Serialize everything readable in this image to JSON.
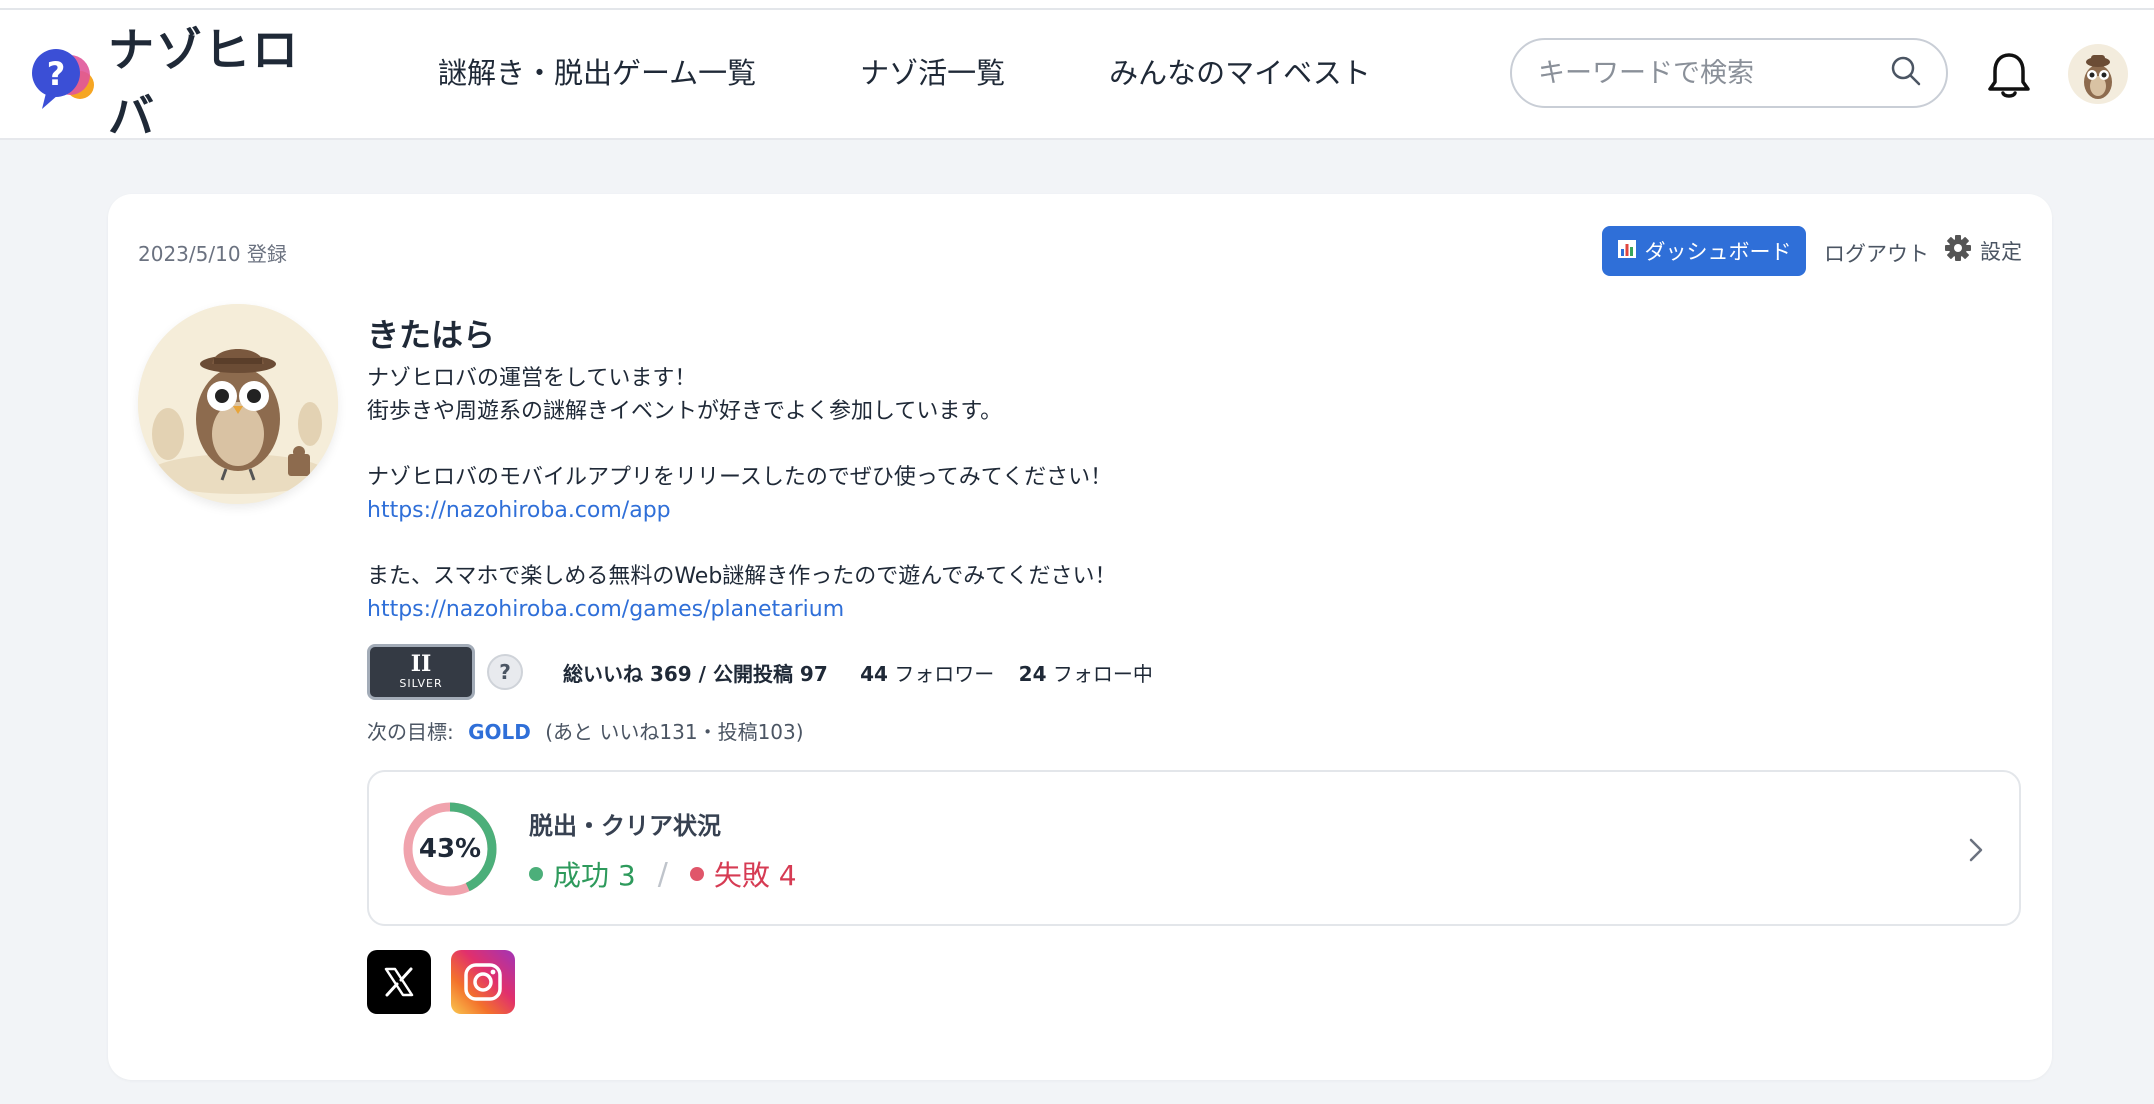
{
  "header": {
    "logo_text": "ナゾヒロバ",
    "nav": [
      {
        "label": "謎解き・脱出ゲーム一覧"
      },
      {
        "label": "ナゾ活一覧"
      },
      {
        "label": "みんなのマイベスト"
      }
    ],
    "search_placeholder": "キーワードで検索",
    "icons": {
      "search": "search-icon",
      "bell": "bell-icon",
      "avatar": "owl-avatar"
    }
  },
  "profile": {
    "registered": "2023/5/10 登録",
    "dashboard_label": "ダッシュボード",
    "logout_label": "ログアウト",
    "settings_label": "設定",
    "name": "きたはら",
    "bio_lines": [
      "ナゾヒロバの運営をしています！",
      "街歩きや周遊系の謎解きイベントが好きでよく参加しています。",
      "",
      "ナゾヒロバのモバイルアプリをリリースしたのでぜひ使ってみてください！",
      "https://nazohiroba.com/app",
      "",
      "また、スマホで楽しめる無料のWeb謎解き作ったので遊んでみてください！",
      "https://nazohiroba.com/games/planetarium"
    ],
    "rank": {
      "roman": "II",
      "label": "SILVER"
    },
    "help_label": "?",
    "stats": {
      "likes_label": "総いいね 369 / 公開投稿 97",
      "followers_count": "44",
      "followers_label": "フォロワー",
      "following_count": "24",
      "following_label": "フォロー中"
    },
    "next_goal": {
      "prefix": "次の目標:",
      "target": "GOLD",
      "remaining": "(あと いいね131・投稿103)"
    },
    "clear_status": {
      "title": "脱出・クリア状況",
      "percent_label": "43%",
      "percent_value": 43,
      "success_label": "成功 3",
      "fail_label": "失敗 4",
      "separator": "/",
      "colors": {
        "success": "#4caf7a",
        "fail": "#f0a3ad"
      }
    },
    "social": [
      {
        "name": "x-logo-icon"
      },
      {
        "name": "instagram-icon"
      }
    ]
  },
  "colors": {
    "accent": "#2f6fd8",
    "link": "#2f6fd8"
  }
}
